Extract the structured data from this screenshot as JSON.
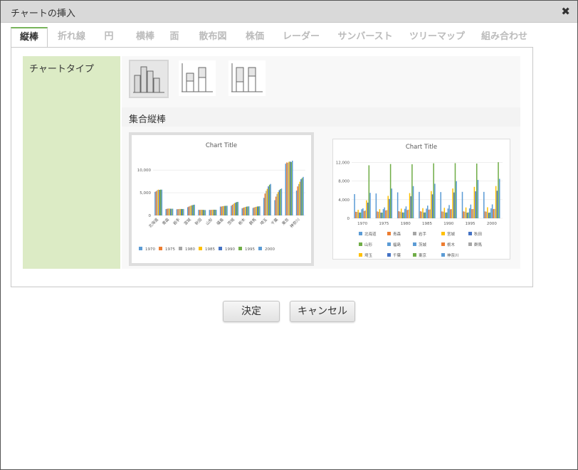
{
  "dialog": {
    "title": "チャートの挿入",
    "close_glyph": "✖"
  },
  "tabs": [
    "縦棒",
    "折れ線",
    "円",
    "横棒",
    "面",
    "散布図",
    "株価",
    "レーダー",
    "サンバースト",
    "ツリーマップ",
    "組み合わせ"
  ],
  "active_tab": 0,
  "section": {
    "label": "チャートタイプ",
    "subtype_title": "集合縦棒"
  },
  "subtypes": [
    "集合縦棒",
    "積み上げ縦棒",
    "100% 積み上げ縦棒"
  ],
  "colors": {
    "accent": "#77b45a",
    "label_bg": "#dcebc5",
    "series": [
      "#5b9bd5",
      "#ed7d31",
      "#a5a5a5",
      "#ffc000",
      "#4472c4",
      "#70ad47",
      "#5b9bd5"
    ]
  },
  "buttons": {
    "ok": "決定",
    "cancel": "キャンセル"
  },
  "chart_data": [
    {
      "type": "bar",
      "title": "Chart Title",
      "categories": [
        "北海道",
        "青森",
        "岩手",
        "宮城",
        "秋田",
        "山形",
        "福島",
        "茨城",
        "栃木",
        "群馬",
        "埼玉",
        "千葉",
        "東京",
        "神奈川"
      ],
      "yticks": [
        "0",
        "5,000",
        "10,000"
      ],
      "ylim": [
        0,
        13000
      ],
      "legend_position": "bottom",
      "series": [
        {
          "name": "1970",
          "values": [
            5200,
            1400,
            1370,
            1820,
            1240,
            1230,
            1950,
            2140,
            1580,
            1660,
            3870,
            3370,
            11400,
            5470
          ]
        },
        {
          "name": "1975",
          "values": [
            5340,
            1470,
            1390,
            1960,
            1230,
            1220,
            1970,
            2340,
            1700,
            1760,
            4820,
            4150,
            11670,
            6400
          ]
        },
        {
          "name": "1980",
          "values": [
            5580,
            1520,
            1420,
            2080,
            1260,
            1250,
            2040,
            2560,
            1790,
            1850,
            5420,
            4740,
            11620,
            6920
          ]
        },
        {
          "name": "1985",
          "values": [
            5680,
            1520,
            1430,
            2180,
            1250,
            1260,
            2080,
            2730,
            1870,
            1920,
            5860,
            5150,
            11830,
            7430
          ]
        },
        {
          "name": "1990",
          "values": [
            5640,
            1480,
            1420,
            2250,
            1230,
            1260,
            2100,
            2850,
            1940,
            1970,
            6410,
            5560,
            11860,
            7980
          ]
        },
        {
          "name": "1995",
          "values": [
            5690,
            1480,
            1420,
            2330,
            1210,
            1260,
            2130,
            2960,
            1980,
            2000,
            6760,
            5800,
            11770,
            8250
          ]
        },
        {
          "name": "2000",
          "values": [
            5680,
            1480,
            1420,
            2370,
            1190,
            1240,
            2130,
            2990,
            2000,
            2020,
            6940,
            5930,
            12060,
            8490
          ]
        }
      ]
    },
    {
      "type": "bar",
      "title": "Chart Title",
      "categories": [
        "1970",
        "1975",
        "1980",
        "1985",
        "1990",
        "1995",
        "2000"
      ],
      "yticks": [
        "0",
        "4,000",
        "8,000",
        "12,000"
      ],
      "ylim": [
        0,
        13000
      ],
      "legend_position": "bottom",
      "series_names": [
        "北海道",
        "青森",
        "岩手",
        "宮城",
        "秋田",
        "山形",
        "福島",
        "茨城",
        "栃木",
        "群馬",
        "埼玉",
        "千葉",
        "東京",
        "神奈川"
      ]
    }
  ]
}
